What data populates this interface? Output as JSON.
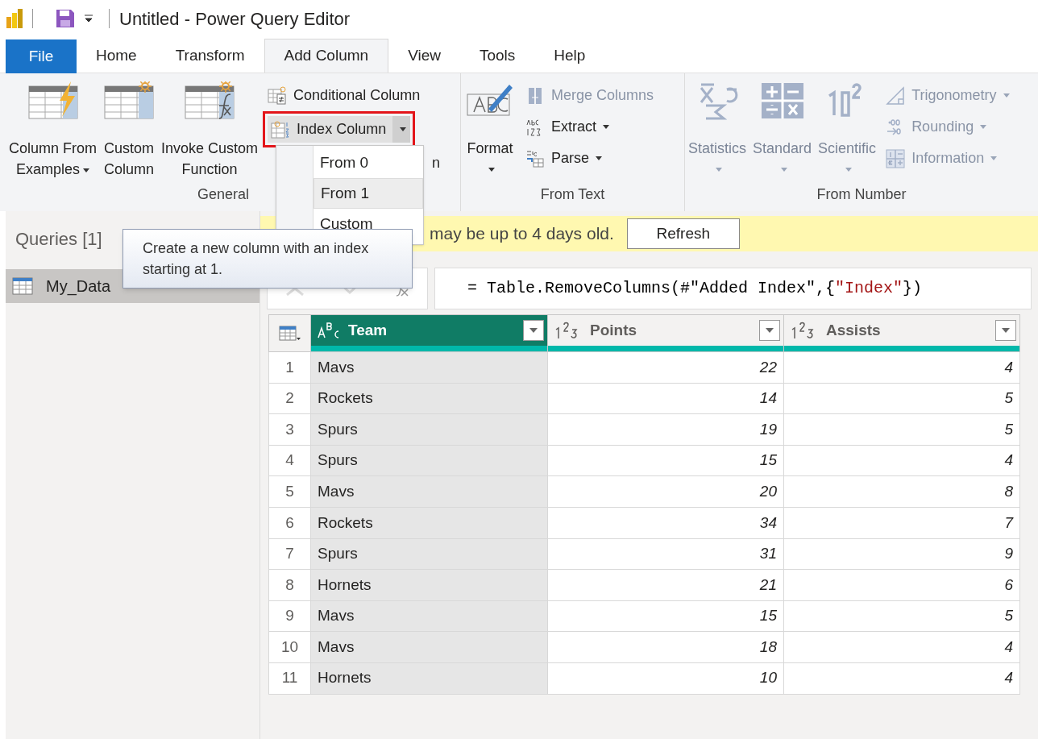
{
  "window": {
    "title": "Untitled - Power Query Editor"
  },
  "file_button": "File",
  "tabs": [
    {
      "label": "Home",
      "selected": false
    },
    {
      "label": "Transform",
      "selected": false
    },
    {
      "label": "Add Column",
      "selected": true
    },
    {
      "label": "View",
      "selected": false
    },
    {
      "label": "Tools",
      "selected": false
    },
    {
      "label": "Help",
      "selected": false
    }
  ],
  "ribbon": {
    "groups": [
      {
        "label": "General",
        "large": [
          {
            "label": "Column From",
            "label2": "Examples",
            "caret": true,
            "disabled": false
          },
          {
            "label": "Custom",
            "label2": "Column",
            "caret": false,
            "disabled": false
          },
          {
            "label": "Invoke Custom",
            "label2": "Function",
            "caret": false,
            "disabled": false
          }
        ],
        "small": [
          {
            "label": "Conditional Column",
            "caret": false,
            "disabled": false,
            "highlighted": false
          },
          {
            "label": "Index Column",
            "caret": true,
            "disabled": false,
            "highlighted": true
          }
        ],
        "partial_label": "n"
      },
      {
        "label": "From Text",
        "large": [
          {
            "label": "Format",
            "caret": true,
            "disabled": false
          }
        ],
        "small": [
          {
            "label": "Merge Columns",
            "caret": false,
            "disabled": true,
            "highlighted": false
          },
          {
            "label": "Extract",
            "caret": true,
            "disabled": false,
            "highlighted": false
          },
          {
            "label": "Parse",
            "caret": true,
            "disabled": false,
            "highlighted": false
          }
        ]
      },
      {
        "label": "From Number",
        "large": [
          {
            "label": "Statistics",
            "caret": true,
            "disabled": true
          },
          {
            "label": "Standard",
            "caret": true,
            "disabled": true
          },
          {
            "label": "Scientific",
            "caret": true,
            "disabled": true
          }
        ],
        "small": [
          {
            "label": "Trigonometry",
            "caret": true,
            "disabled": true,
            "highlighted": false
          },
          {
            "label": "Rounding",
            "caret": true,
            "disabled": true,
            "highlighted": false
          },
          {
            "label": "Information",
            "caret": true,
            "disabled": true,
            "highlighted": false
          }
        ]
      }
    ]
  },
  "dropdown": {
    "items": [
      {
        "label": "From 0",
        "selected": false
      },
      {
        "label": "From 1",
        "selected": true
      },
      {
        "label": "Custom",
        "selected": false
      }
    ]
  },
  "tooltip": "Create a new column with an index starting at 1.",
  "queries": {
    "title": "Queries [1]",
    "items": [
      {
        "name": "My_Data",
        "selected": true
      }
    ]
  },
  "info_bar": {
    "message": "may be up to 4 days old.",
    "button": "Refresh"
  },
  "formula": {
    "parts": [
      {
        "kind": "code",
        "text": "= Table.RemoveColumns(#\"Added Index\",{"
      },
      {
        "kind": "string",
        "text": "\"Index\""
      },
      {
        "kind": "code",
        "text": "})"
      }
    ]
  },
  "table": {
    "columns": [
      {
        "name": "Team",
        "kind": "text",
        "selected": true
      },
      {
        "name": "Points",
        "kind": "number",
        "selected": false
      },
      {
        "name": "Assists",
        "kind": "number",
        "selected": false
      }
    ],
    "rows": [
      {
        "index": "1",
        "cells": [
          "Mavs",
          "22",
          "4"
        ]
      },
      {
        "index": "2",
        "cells": [
          "Rockets",
          "14",
          "5"
        ]
      },
      {
        "index": "3",
        "cells": [
          "Spurs",
          "19",
          "5"
        ]
      },
      {
        "index": "4",
        "cells": [
          "Spurs",
          "15",
          "4"
        ]
      },
      {
        "index": "5",
        "cells": [
          "Mavs",
          "20",
          "8"
        ]
      },
      {
        "index": "6",
        "cells": [
          "Rockets",
          "34",
          "7"
        ]
      },
      {
        "index": "7",
        "cells": [
          "Spurs",
          "31",
          "9"
        ]
      },
      {
        "index": "8",
        "cells": [
          "Hornets",
          "21",
          "6"
        ]
      },
      {
        "index": "9",
        "cells": [
          "Mavs",
          "15",
          "5"
        ]
      },
      {
        "index": "10",
        "cells": [
          "Mavs",
          "18",
          "4"
        ]
      },
      {
        "index": "11",
        "cells": [
          "Hornets",
          "10",
          "4"
        ]
      }
    ]
  }
}
